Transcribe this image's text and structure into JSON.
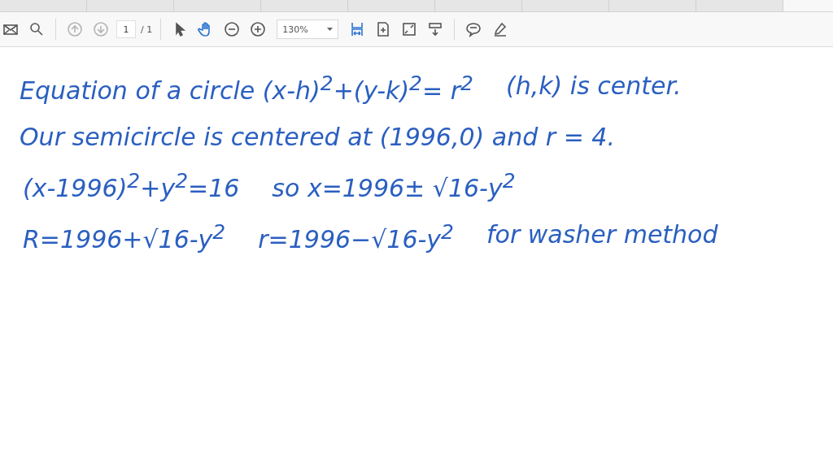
{
  "tabs": [
    {
      "selected": false
    },
    {
      "selected": false
    },
    {
      "selected": false
    },
    {
      "selected": false
    },
    {
      "selected": false
    },
    {
      "selected": false
    },
    {
      "selected": false
    },
    {
      "selected": false
    },
    {
      "selected": false
    },
    {
      "selected": true
    }
  ],
  "toolbar": {
    "nav": [
      {
        "kind": "up",
        "disabled": true
      },
      {
        "kind": "down",
        "disabled": true
      }
    ],
    "page_field": {
      "value": "1"
    },
    "page_total": "/ 1",
    "tools": [
      {
        "kind": "pointer",
        "selected": false
      },
      {
        "kind": "hand",
        "selected": true
      }
    ],
    "zoom": {
      "value": "130%"
    }
  },
  "document": {
    "lines": [
      [
        "Equation of a circle  (x-h)$^{2}$+(y-k)$^{2}$= r$^{2}$",
        "(h,k) is center."
      ],
      [
        "Our semicircle is centered at (1996,0) and r = 4."
      ],
      [
        "(x-1996)$^{2}$+y$^{2}$=16",
        "so x=1996± √16-y$^{2}$"
      ],
      [
        "R=1996+√16-y$^{2}$",
        "r=1996−√16-y$^{2}$",
        "for washer method"
      ]
    ]
  }
}
